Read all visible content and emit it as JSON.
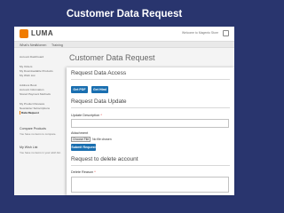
{
  "hero": {
    "title": "Customer Data Request"
  },
  "site": {
    "logo_text": "LUMA",
    "welcome": "Welcome to Magento Store",
    "nav": [
      "What's New",
      "Women",
      "Training"
    ],
    "page_title": "Customer Data Request"
  },
  "sidebar": {
    "items": [
      {
        "label": "Account Dashboard"
      },
      {
        "label": "My Orders"
      },
      {
        "label": "My Downloadable Products"
      },
      {
        "label": "My Wish List"
      },
      {
        "label": "Address Book"
      },
      {
        "label": "Account Information"
      },
      {
        "label": "Stored Payment Methods"
      },
      {
        "label": "My Product Reviews"
      },
      {
        "label": "Newsletter Subscriptions"
      },
      {
        "label": "Data Request"
      }
    ],
    "compare_heading": "Compare Products",
    "compare_note": "You have no items to compare.",
    "wishlist_heading": "My Wish List",
    "wishlist_note": "You have no items in your wish list."
  },
  "modal": {
    "access_title": "Request Data Access",
    "get_pdf": "Get PDF",
    "get_html": "Get Html",
    "update_title": "Request Data Update",
    "update_label": "Update Description",
    "attachment_label": "Attachment",
    "choose_file": "Choose File",
    "no_file": "No file chosen",
    "submit": "Submit Request",
    "delete_title": "Request to delete account",
    "delete_label": "Delete Reason"
  },
  "colors": {
    "primary_button": "#1a6fb0",
    "hero_bg": "#29356e",
    "accent": "#f07c00"
  }
}
